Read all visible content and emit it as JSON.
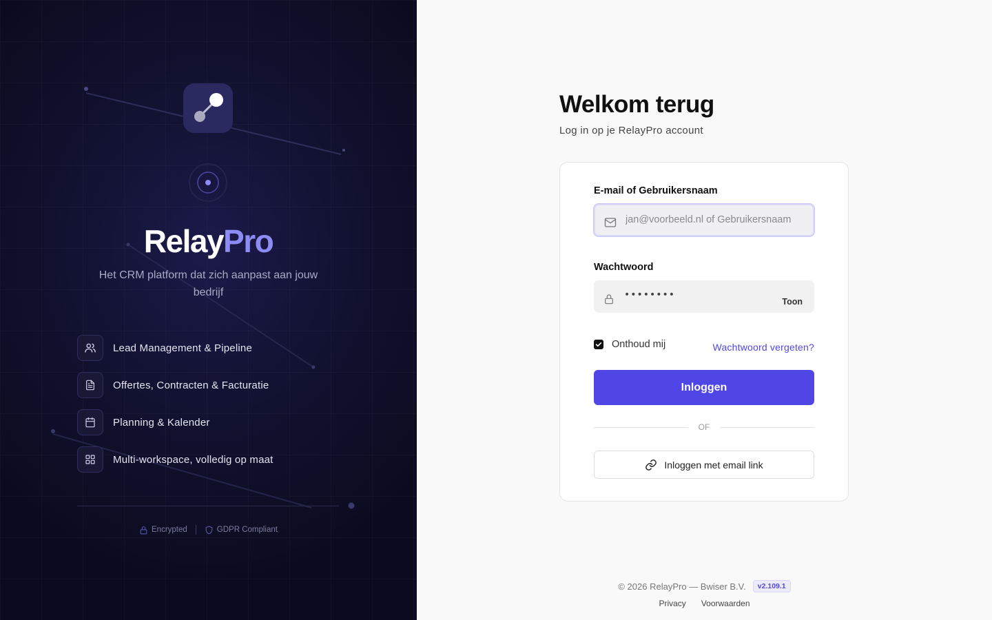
{
  "brand": {
    "part1": "Relay",
    "part2": "Pro"
  },
  "tagline": "Het CRM platform dat zich aanpast aan jouw bedrijf",
  "features": [
    {
      "icon": "users-icon",
      "label": "Lead Management & Pipeline"
    },
    {
      "icon": "document-icon",
      "label": "Offertes, Contracten & Facturatie"
    },
    {
      "icon": "calendar-icon",
      "label": "Planning & Kalender"
    },
    {
      "icon": "grid-icon",
      "label": "Multi-workspace, volledig op maat"
    }
  ],
  "trust": {
    "encrypted": "Encrypted",
    "gdpr": "GDPR Compliant"
  },
  "login": {
    "title": "Welkom terug",
    "subtitle": "Log in op je RelayPro account",
    "email_label": "E-mail of Gebruikersnaam",
    "email_placeholder": "jan@voorbeeld.nl of Gebruikersnaam",
    "password_label": "Wachtwoord",
    "password_value": "••••••••",
    "show_password": "Toon",
    "remember_me": "Onthoud mij",
    "remember_checked": true,
    "forgot_password": "Wachtwoord vergeten?",
    "submit": "Inloggen",
    "or": "OF",
    "magic_link": "Inloggen met email link"
  },
  "footer": {
    "copyright": "© 2026 RelayPro — Bwiser B.V.",
    "version": "v2.109.1",
    "privacy": "Privacy",
    "terms": "Voorwaarden"
  },
  "colors": {
    "accent": "#4f46e5",
    "accent_light": "#8d8cf5",
    "left_bg": "#121232"
  }
}
